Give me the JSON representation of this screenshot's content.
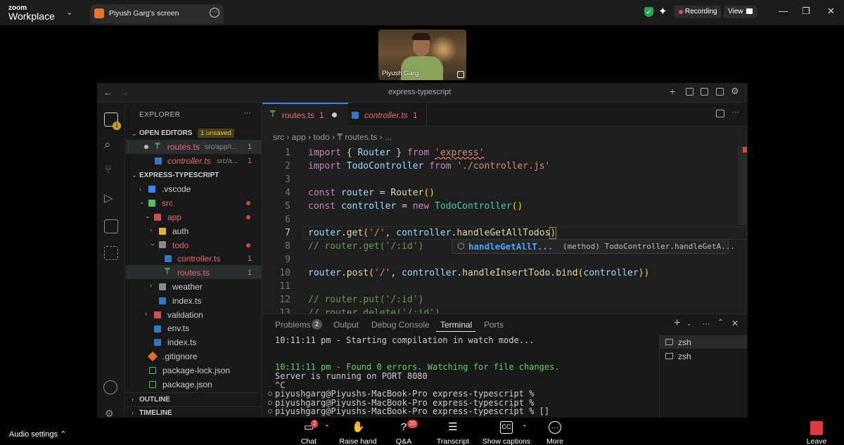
{
  "zoom": {
    "logo_small": "zoom",
    "logo_big": "Workplace",
    "share_title": "Piyush Garg's screen",
    "recording_label": "Recording",
    "view_label": "View",
    "speaker_name": "Piyush Garg",
    "audio_settings": "Audio settings",
    "toolbar": [
      {
        "label": "Chat",
        "icon": "chat-icon",
        "badge": "2"
      },
      {
        "label": "Raise hand",
        "icon": "raise-hand-icon",
        "badge": ""
      },
      {
        "label": "Q&A",
        "icon": "qa-icon",
        "badge": "20"
      },
      {
        "label": "Transcript",
        "icon": "transcript-icon",
        "badge": ""
      },
      {
        "label": "Show captions",
        "icon": "captions-icon",
        "badge": ""
      },
      {
        "label": "More",
        "icon": "more-icon",
        "badge": ""
      }
    ],
    "leave_label": "Leave",
    "colors": {
      "recording_dot": "#ff4040",
      "leave": "#e23a3a",
      "shield": "#26a55b"
    }
  },
  "vscode": {
    "window_title": "express-typescript",
    "explorer_title": "EXPLORER",
    "open_editors_label": "OPEN EDITORS",
    "unsaved_badge": "1 unsaved",
    "open_editors": [
      {
        "name": "routes.ts",
        "path": "src/app/t...",
        "errors": "1",
        "modified": true
      },
      {
        "name": "controller.ts",
        "path": "src/a...",
        "errors": "1",
        "modified": false
      }
    ],
    "project_label": "EXPRESS-TYPESCRIPT",
    "tree": [
      {
        "name": ".vscode",
        "indent": 0,
        "chevron": "›",
        "errors": ""
      },
      {
        "name": "src",
        "indent": 0,
        "chevron": "⌄",
        "errors": "",
        "dot": true
      },
      {
        "name": "app",
        "indent": 1,
        "chevron": "⌄",
        "errors": "",
        "dot": true
      },
      {
        "name": "auth",
        "indent": 2,
        "chevron": "›",
        "errors": ""
      },
      {
        "name": "todo",
        "indent": 2,
        "chevron": "⌄",
        "errors": "",
        "dot": true
      },
      {
        "name": "controller.ts",
        "indent": 3,
        "chevron": "",
        "errors": "1"
      },
      {
        "name": "routes.ts",
        "indent": 3,
        "chevron": "",
        "errors": "1"
      },
      {
        "name": "weather",
        "indent": 2,
        "chevron": "›",
        "errors": ""
      },
      {
        "name": "index.ts",
        "indent": 2,
        "chevron": "",
        "errors": ""
      },
      {
        "name": "validation",
        "indent": 1,
        "chevron": "›",
        "errors": ""
      },
      {
        "name": "env.ts",
        "indent": 1,
        "chevron": "",
        "errors": ""
      },
      {
        "name": "index.ts",
        "indent": 1,
        "chevron": "",
        "errors": ""
      },
      {
        "name": ".gitignore",
        "indent": 0,
        "chevron": "",
        "errors": ""
      },
      {
        "name": "package-lock.json",
        "indent": 0,
        "chevron": "",
        "errors": ""
      },
      {
        "name": "package.json",
        "indent": 0,
        "chevron": "",
        "errors": ""
      }
    ],
    "outline_label": "OUTLINE",
    "timeline_label": "TIMELINE",
    "tabs": [
      {
        "name": "routes.ts",
        "errors": "1"
      },
      {
        "name": "controller.ts",
        "errors": "1"
      }
    ],
    "breadcrumb": [
      "src",
      "app",
      "todo",
      "routes.ts",
      "..."
    ],
    "line_numbers": [
      "1",
      "2",
      "3",
      "4",
      "5",
      "6",
      "7",
      "8",
      "9",
      "10",
      "11",
      "12",
      "13"
    ],
    "suggestion": {
      "name": "handleGetAllT...",
      "detail": "(method) TodoController.handleGetA..."
    },
    "panel_tabs": [
      "Problems",
      "Output",
      "Debug Console",
      "Terminal",
      "Ports"
    ],
    "problems_count": "2",
    "terminal": [
      "10:11:11 pm - Starting compilation in watch mode...",
      "",
      "",
      "10:11:11 pm - Found 0 errors. Watching for file changes.",
      "Server is running on PORT 8080",
      "^C",
      "piyushgarg@Piyushs-MacBook-Pro express-typescript %",
      "piyushgarg@Piyushs-MacBook-Pro express-typescript %",
      "piyushgarg@Piyushs-MacBook-Pro express-typescript % []"
    ],
    "terminals": [
      "zsh",
      "zsh"
    ]
  }
}
